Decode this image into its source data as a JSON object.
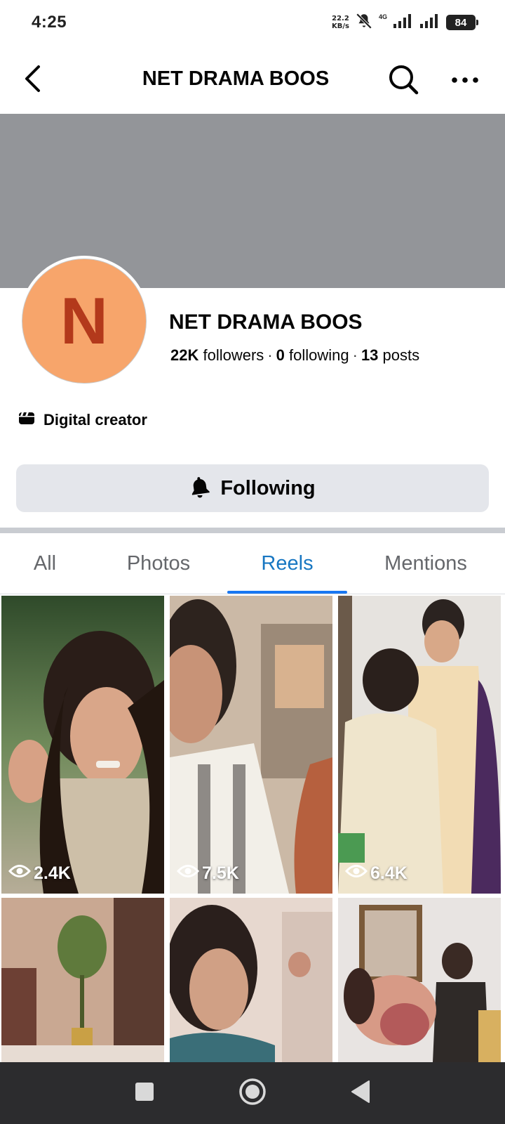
{
  "status_bar": {
    "time": "4:25",
    "net_speed_value": "22.2",
    "net_speed_unit": "KB/s",
    "network_type": "4G",
    "battery": "84"
  },
  "header": {
    "title": "NET DRAMA BOOS"
  },
  "profile": {
    "avatar_letter": "N",
    "name": "NET DRAMA BOOS",
    "followers_count": "22K",
    "followers_label": "followers",
    "following_count": "0",
    "following_label": "following",
    "posts_count": "13",
    "posts_label": "posts",
    "category": "Digital creator",
    "follow_button_label": "Following"
  },
  "tabs": [
    {
      "label": "All",
      "active": false
    },
    {
      "label": "Photos",
      "active": false
    },
    {
      "label": "Reels",
      "active": true
    },
    {
      "label": "Mentions",
      "active": false
    }
  ],
  "reels": [
    {
      "views": "2.4K"
    },
    {
      "views": "7.5K"
    },
    {
      "views": "6.4K"
    },
    {
      "views": ""
    },
    {
      "views": ""
    },
    {
      "views": ""
    }
  ],
  "colors": {
    "accent": "#1877f2",
    "cover": "#939599",
    "avatar_bg": "#f7a56b",
    "avatar_letter": "#b3391b",
    "button_bg": "#e4e6eb"
  },
  "icons": {
    "back": "chevron-left-icon",
    "search": "search-icon",
    "more": "more-dots-icon",
    "category": "clapperboard-icon",
    "bell": "bell-icon",
    "views": "eye-icon"
  }
}
